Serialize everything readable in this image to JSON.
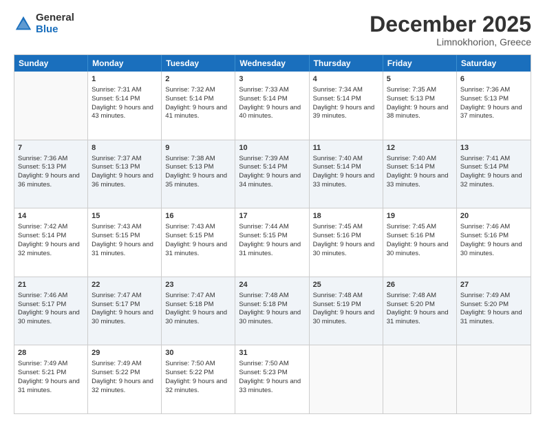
{
  "logo": {
    "general": "General",
    "blue": "Blue"
  },
  "header": {
    "month": "December 2025",
    "location": "Limnokhorion, Greece"
  },
  "weekdays": [
    "Sunday",
    "Monday",
    "Tuesday",
    "Wednesday",
    "Thursday",
    "Friday",
    "Saturday"
  ],
  "rows": [
    [
      {
        "day": "",
        "sunrise": "",
        "sunset": "",
        "daylight": "",
        "empty": true
      },
      {
        "day": "1",
        "sunrise": "Sunrise: 7:31 AM",
        "sunset": "Sunset: 5:14 PM",
        "daylight": "Daylight: 9 hours and 43 minutes."
      },
      {
        "day": "2",
        "sunrise": "Sunrise: 7:32 AM",
        "sunset": "Sunset: 5:14 PM",
        "daylight": "Daylight: 9 hours and 41 minutes."
      },
      {
        "day": "3",
        "sunrise": "Sunrise: 7:33 AM",
        "sunset": "Sunset: 5:14 PM",
        "daylight": "Daylight: 9 hours and 40 minutes."
      },
      {
        "day": "4",
        "sunrise": "Sunrise: 7:34 AM",
        "sunset": "Sunset: 5:14 PM",
        "daylight": "Daylight: 9 hours and 39 minutes."
      },
      {
        "day": "5",
        "sunrise": "Sunrise: 7:35 AM",
        "sunset": "Sunset: 5:13 PM",
        "daylight": "Daylight: 9 hours and 38 minutes."
      },
      {
        "day": "6",
        "sunrise": "Sunrise: 7:36 AM",
        "sunset": "Sunset: 5:13 PM",
        "daylight": "Daylight: 9 hours and 37 minutes."
      }
    ],
    [
      {
        "day": "7",
        "sunrise": "Sunrise: 7:36 AM",
        "sunset": "Sunset: 5:13 PM",
        "daylight": "Daylight: 9 hours and 36 minutes."
      },
      {
        "day": "8",
        "sunrise": "Sunrise: 7:37 AM",
        "sunset": "Sunset: 5:13 PM",
        "daylight": "Daylight: 9 hours and 36 minutes."
      },
      {
        "day": "9",
        "sunrise": "Sunrise: 7:38 AM",
        "sunset": "Sunset: 5:13 PM",
        "daylight": "Daylight: 9 hours and 35 minutes."
      },
      {
        "day": "10",
        "sunrise": "Sunrise: 7:39 AM",
        "sunset": "Sunset: 5:14 PM",
        "daylight": "Daylight: 9 hours and 34 minutes."
      },
      {
        "day": "11",
        "sunrise": "Sunrise: 7:40 AM",
        "sunset": "Sunset: 5:14 PM",
        "daylight": "Daylight: 9 hours and 33 minutes."
      },
      {
        "day": "12",
        "sunrise": "Sunrise: 7:40 AM",
        "sunset": "Sunset: 5:14 PM",
        "daylight": "Daylight: 9 hours and 33 minutes."
      },
      {
        "day": "13",
        "sunrise": "Sunrise: 7:41 AM",
        "sunset": "Sunset: 5:14 PM",
        "daylight": "Daylight: 9 hours and 32 minutes."
      }
    ],
    [
      {
        "day": "14",
        "sunrise": "Sunrise: 7:42 AM",
        "sunset": "Sunset: 5:14 PM",
        "daylight": "Daylight: 9 hours and 32 minutes."
      },
      {
        "day": "15",
        "sunrise": "Sunrise: 7:43 AM",
        "sunset": "Sunset: 5:15 PM",
        "daylight": "Daylight: 9 hours and 31 minutes."
      },
      {
        "day": "16",
        "sunrise": "Sunrise: 7:43 AM",
        "sunset": "Sunset: 5:15 PM",
        "daylight": "Daylight: 9 hours and 31 minutes."
      },
      {
        "day": "17",
        "sunrise": "Sunrise: 7:44 AM",
        "sunset": "Sunset: 5:15 PM",
        "daylight": "Daylight: 9 hours and 31 minutes."
      },
      {
        "day": "18",
        "sunrise": "Sunrise: 7:45 AM",
        "sunset": "Sunset: 5:16 PM",
        "daylight": "Daylight: 9 hours and 30 minutes."
      },
      {
        "day": "19",
        "sunrise": "Sunrise: 7:45 AM",
        "sunset": "Sunset: 5:16 PM",
        "daylight": "Daylight: 9 hours and 30 minutes."
      },
      {
        "day": "20",
        "sunrise": "Sunrise: 7:46 AM",
        "sunset": "Sunset: 5:16 PM",
        "daylight": "Daylight: 9 hours and 30 minutes."
      }
    ],
    [
      {
        "day": "21",
        "sunrise": "Sunrise: 7:46 AM",
        "sunset": "Sunset: 5:17 PM",
        "daylight": "Daylight: 9 hours and 30 minutes."
      },
      {
        "day": "22",
        "sunrise": "Sunrise: 7:47 AM",
        "sunset": "Sunset: 5:17 PM",
        "daylight": "Daylight: 9 hours and 30 minutes."
      },
      {
        "day": "23",
        "sunrise": "Sunrise: 7:47 AM",
        "sunset": "Sunset: 5:18 PM",
        "daylight": "Daylight: 9 hours and 30 minutes."
      },
      {
        "day": "24",
        "sunrise": "Sunrise: 7:48 AM",
        "sunset": "Sunset: 5:18 PM",
        "daylight": "Daylight: 9 hours and 30 minutes."
      },
      {
        "day": "25",
        "sunrise": "Sunrise: 7:48 AM",
        "sunset": "Sunset: 5:19 PM",
        "daylight": "Daylight: 9 hours and 30 minutes."
      },
      {
        "day": "26",
        "sunrise": "Sunrise: 7:48 AM",
        "sunset": "Sunset: 5:20 PM",
        "daylight": "Daylight: 9 hours and 31 minutes."
      },
      {
        "day": "27",
        "sunrise": "Sunrise: 7:49 AM",
        "sunset": "Sunset: 5:20 PM",
        "daylight": "Daylight: 9 hours and 31 minutes."
      }
    ],
    [
      {
        "day": "28",
        "sunrise": "Sunrise: 7:49 AM",
        "sunset": "Sunset: 5:21 PM",
        "daylight": "Daylight: 9 hours and 31 minutes."
      },
      {
        "day": "29",
        "sunrise": "Sunrise: 7:49 AM",
        "sunset": "Sunset: 5:22 PM",
        "daylight": "Daylight: 9 hours and 32 minutes."
      },
      {
        "day": "30",
        "sunrise": "Sunrise: 7:50 AM",
        "sunset": "Sunset: 5:22 PM",
        "daylight": "Daylight: 9 hours and 32 minutes."
      },
      {
        "day": "31",
        "sunrise": "Sunrise: 7:50 AM",
        "sunset": "Sunset: 5:23 PM",
        "daylight": "Daylight: 9 hours and 33 minutes."
      },
      {
        "day": "",
        "sunrise": "",
        "sunset": "",
        "daylight": "",
        "empty": true
      },
      {
        "day": "",
        "sunrise": "",
        "sunset": "",
        "daylight": "",
        "empty": true
      },
      {
        "day": "",
        "sunrise": "",
        "sunset": "",
        "daylight": "",
        "empty": true
      }
    ]
  ]
}
